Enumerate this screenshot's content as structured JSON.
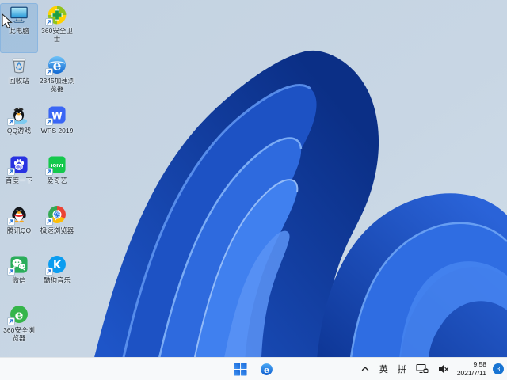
{
  "palette": {
    "wallpaper_bg": "#c7d6e4",
    "bloom_dark": "#0c3190",
    "bloom_mid": "#2a63d8",
    "bloom_bright": "#4080ef",
    "taskbar_bg": "#f7f9fa",
    "badge_blue": "#1874d2",
    "selection_highlight": "#69a0d7"
  },
  "desktop_icons": [
    {
      "id": "this-pc",
      "label": "此电脑",
      "selected": true,
      "shortcut": false
    },
    {
      "id": "recycle-bin",
      "label": "回收站",
      "selected": false,
      "shortcut": false
    },
    {
      "id": "qq-games",
      "label": "QQ游戏",
      "selected": false,
      "shortcut": true
    },
    {
      "id": "baidu",
      "label": "百度一下",
      "selected": false,
      "shortcut": true
    },
    {
      "id": "tencent-qq",
      "label": "腾讯QQ",
      "selected": false,
      "shortcut": true
    },
    {
      "id": "wechat",
      "label": "微信",
      "selected": false,
      "shortcut": true
    },
    {
      "id": "360-browser",
      "label": "360安全浏览器",
      "selected": false,
      "shortcut": true
    },
    {
      "id": "360-safe",
      "label": "360安全卫士",
      "selected": false,
      "shortcut": true
    },
    {
      "id": "2345-browser",
      "label": "2345加速浏览器",
      "selected": false,
      "shortcut": true
    },
    {
      "id": "wps-2019",
      "label": "WPS 2019",
      "selected": false,
      "shortcut": true
    },
    {
      "id": "iqiyi",
      "label": "爱奇艺",
      "selected": false,
      "shortcut": true
    },
    {
      "id": "speed-browser",
      "label": "极速浏览器",
      "selected": false,
      "shortcut": true
    },
    {
      "id": "kugou",
      "label": "酷狗音乐",
      "selected": false,
      "shortcut": true
    }
  ],
  "taskbar": {
    "center_icons": [
      "start",
      "browser-e"
    ],
    "tray": {
      "icons": [
        "chevron-up",
        "network-monitor",
        "volume-muted"
      ],
      "ime_language": "英",
      "ime_mode": "拼",
      "clock_time": "9:58",
      "clock_date": "2021/7/11",
      "notification_badge": "3"
    }
  }
}
